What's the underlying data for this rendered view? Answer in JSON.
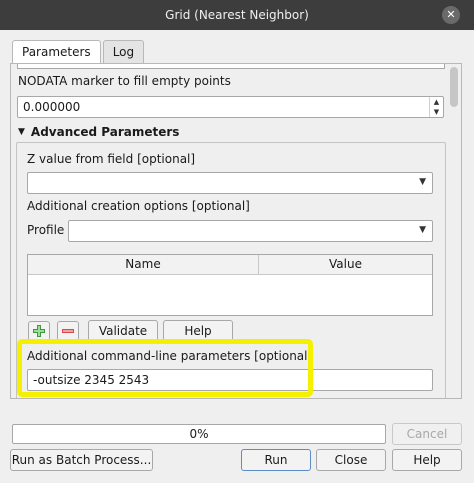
{
  "window": {
    "title": "Grid (Nearest Neighbor)",
    "close_glyph": "✕"
  },
  "tabs": [
    {
      "label": "Parameters"
    },
    {
      "label": "Log"
    }
  ],
  "params": {
    "nodata_label": "NODATA marker to fill empty points",
    "nodata_value": "0.000000",
    "advanced_title": "Advanced Parameters",
    "zfield_label": "Z value from field [optional]",
    "zfield_value": "",
    "creation_label": "Additional creation options [optional]",
    "profile_label": "Profile",
    "profile_value": "",
    "table_headers": [
      "Name",
      "Value"
    ],
    "validate_label": "Validate",
    "help_label": "Help",
    "cmdline_label": "Additional command-line parameters [optional]",
    "cmdline_value": "-outsize 2345 2543"
  },
  "footer": {
    "progress_text": "0%",
    "progress_fraction": 0,
    "cancel_label": "Cancel",
    "batch_label": "Run as Batch Process...",
    "run_label": "Run",
    "close_label": "Close",
    "help_label": "Help"
  },
  "colors": {
    "highlight": "#f5f000",
    "add_icon": "#3c9a3c",
    "remove_icon": "#d94a4a"
  }
}
